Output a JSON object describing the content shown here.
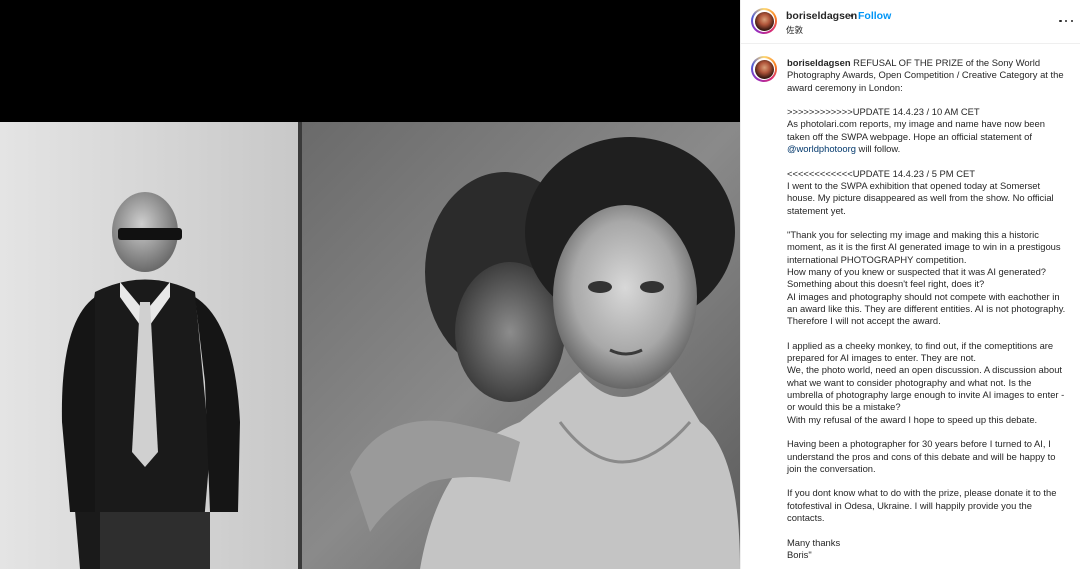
{
  "post": {
    "username": "boriseldagsen",
    "dot": "•",
    "follow_label": "Follow",
    "location": "佐敦"
  },
  "caption": {
    "username": "boriseldagsen",
    "intro": "REFUSAL OF THE PRIZE of the Sony World Photography Awards, Open Competition / Creative Category at the award ceremony in London:",
    "update1_line1": ">>>>>>>>>>>>UPDATE 14.4.23 / 10 AM CET",
    "update1_line2": "As photolari.com reports, my image and name have now been taken off the SWPA webpage. Hope an official statement of ",
    "update1_mention": "@worldphotoorg",
    "update1_end": " will follow.",
    "update2_line1": "<<<<<<<<<<<<UPDATE 14.4.23 / 5 PM CET",
    "update2_line2": "I went to the SWPA exhibition that opened today at Somerset house. My picture disappeared as well from the show. No official statement yet.",
    "para_thanks": "\"Thank you for selecting my image and making this a historic moment, as it is the first AI generated image to win in a prestigous international PHOTOGRAPHY competition.\nHow many of you knew or suspected that it was AI generated? Something about this doesn't feel right, does it?\nAI images and photography should not compete with eachother in an award like this. They are different entities. AI is not photography. Therefore I will not accept the award.",
    "para_monkey": "I applied as a cheeky monkey, to find out, if the comeptitions are prepared for AI images to enter. They are not.\nWe, the photo world, need an open discussion. A discussion about what we want to consider photography and what not. Is the umbrella of photography large enough to invite AI images to enter - or would this be a mistake?\nWith my refusal of the award I hope to speed up this debate.",
    "para_30years": "Having been a photographer for 30 years before I turned to AI, I understand the pros and cons of this debate and will be happy to join the conversation.",
    "para_donate": "If you dont know what to do with the prize, please donate it to the fotofestival in Odesa, Ukraine. I will happily provide you the contacts.",
    "para_signoff": "Many thanks\nBoris\""
  },
  "colors": {
    "link_blue": "#0095f6",
    "mention": "#00376b",
    "text": "#262626"
  }
}
